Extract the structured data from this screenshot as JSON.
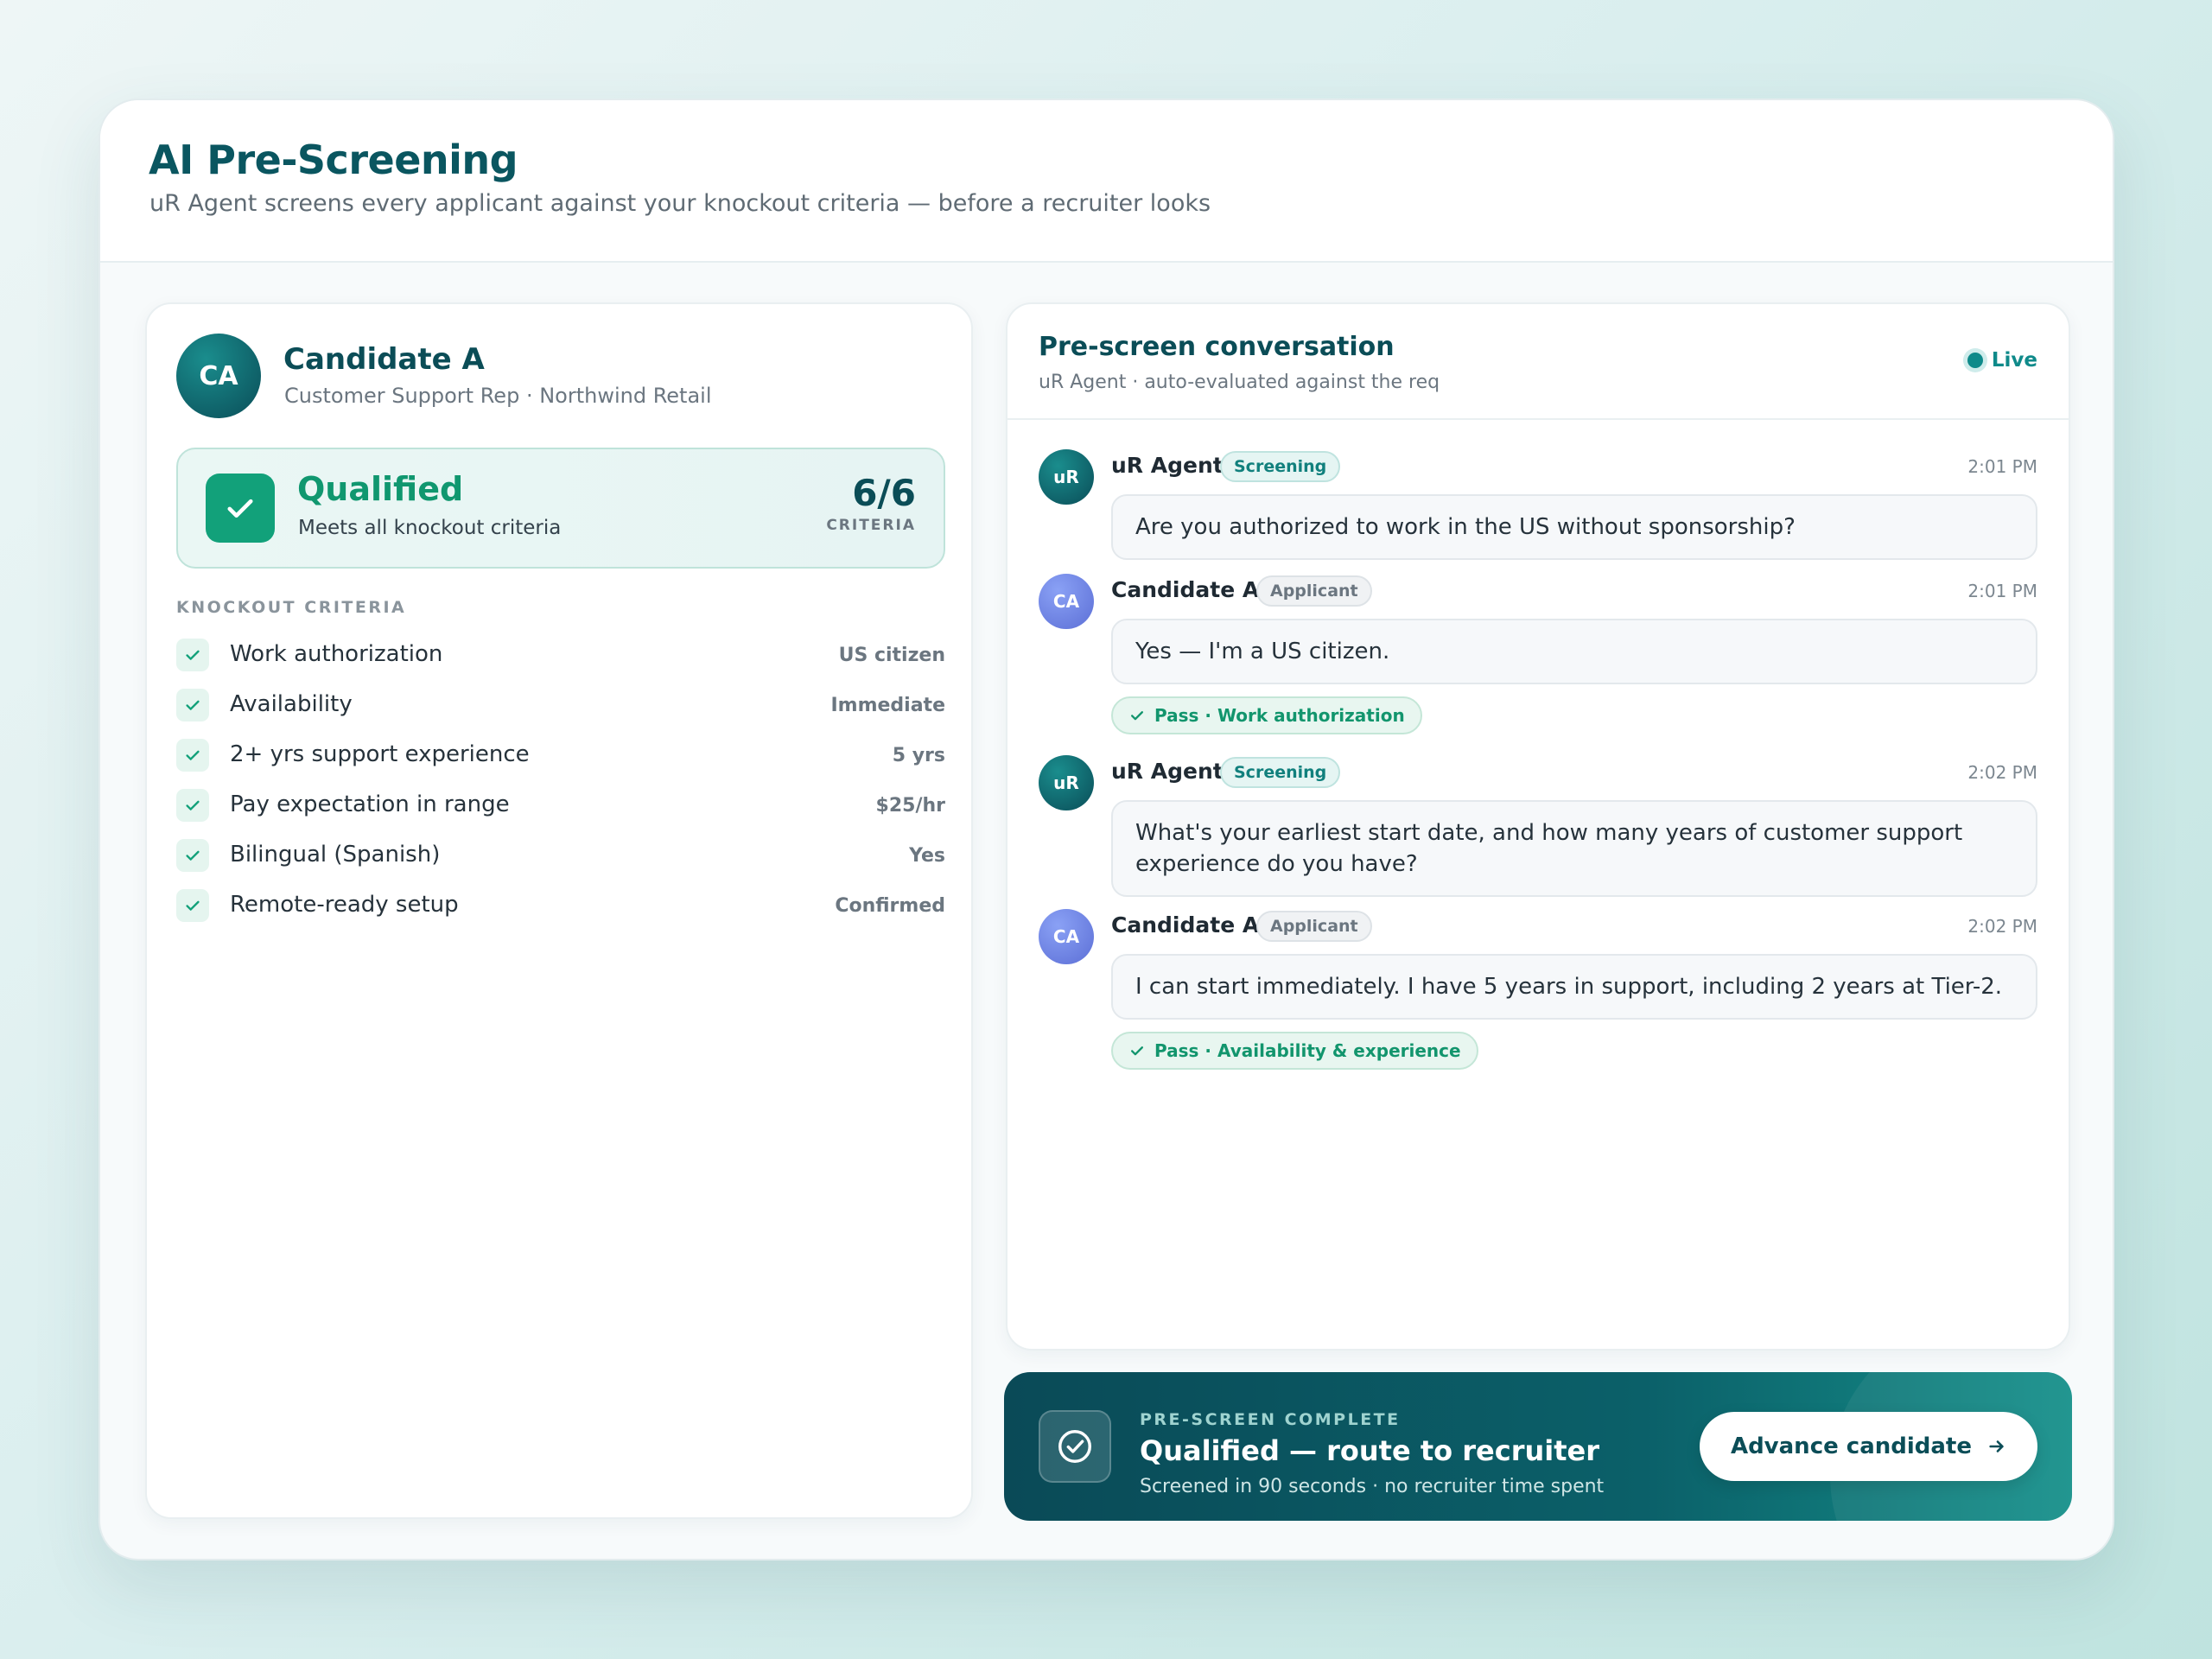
{
  "header": {
    "title": "AI Pre-Screening",
    "subtitle": "uR Agent screens every applicant against your knockout criteria — before a recruiter looks"
  },
  "candidate": {
    "initials": "CA",
    "name": "Candidate A",
    "role": "Customer Support Rep · Northwind Retail"
  },
  "qualification": {
    "status": "Qualified",
    "description": "Meets all knockout criteria",
    "count": "6/6",
    "count_label": "CRITERIA"
  },
  "criteria": {
    "section_label": "KNOCKOUT CRITERIA",
    "items": [
      {
        "label": "Work authorization",
        "value": "US citizen"
      },
      {
        "label": "Availability",
        "value": "Immediate"
      },
      {
        "label": "2+ yrs support experience",
        "value": "5 yrs"
      },
      {
        "label": "Pay expectation in range",
        "value": "$25/hr"
      },
      {
        "label": "Bilingual (Spanish)",
        "value": "Yes"
      },
      {
        "label": "Remote-ready setup",
        "value": "Confirmed"
      }
    ]
  },
  "conversation": {
    "title": "Pre-screen conversation",
    "subtitle": "uR Agent · auto-evaluated against the req",
    "live_label": "Live",
    "messages": [
      {
        "initials": "uR",
        "sender": "uR Agent",
        "tag": "Screening",
        "time": "2:01 PM",
        "text": "Are you authorized to work in the US without sponsorship?"
      },
      {
        "initials": "CA",
        "sender": "Candidate A",
        "tag": "Applicant",
        "time": "2:01 PM",
        "text": "Yes — I'm a US citizen.",
        "pass": "Pass · Work authorization"
      },
      {
        "initials": "uR",
        "sender": "uR Agent",
        "tag": "Screening",
        "time": "2:02 PM",
        "text": "What's your earliest start date, and how many years of customer support experience do you have?"
      },
      {
        "initials": "CA",
        "sender": "Candidate A",
        "tag": "Applicant",
        "time": "2:02 PM",
        "text": "I can start immediately. I have 5 years in support, including 2 years at Tier-2.",
        "pass": "Pass · Availability & experience"
      }
    ]
  },
  "banner": {
    "kicker": "PRE-SCREEN COMPLETE",
    "title": "Qualified — route to recruiter",
    "subtitle": "Screened in 90 seconds · no recruiter time spent",
    "button_label": "Advance candidate",
    "icon": "check-circle-icon"
  },
  "colors": {
    "brand": "#0b4d57",
    "accent": "#0f8a8a",
    "success": "#12a17a"
  }
}
